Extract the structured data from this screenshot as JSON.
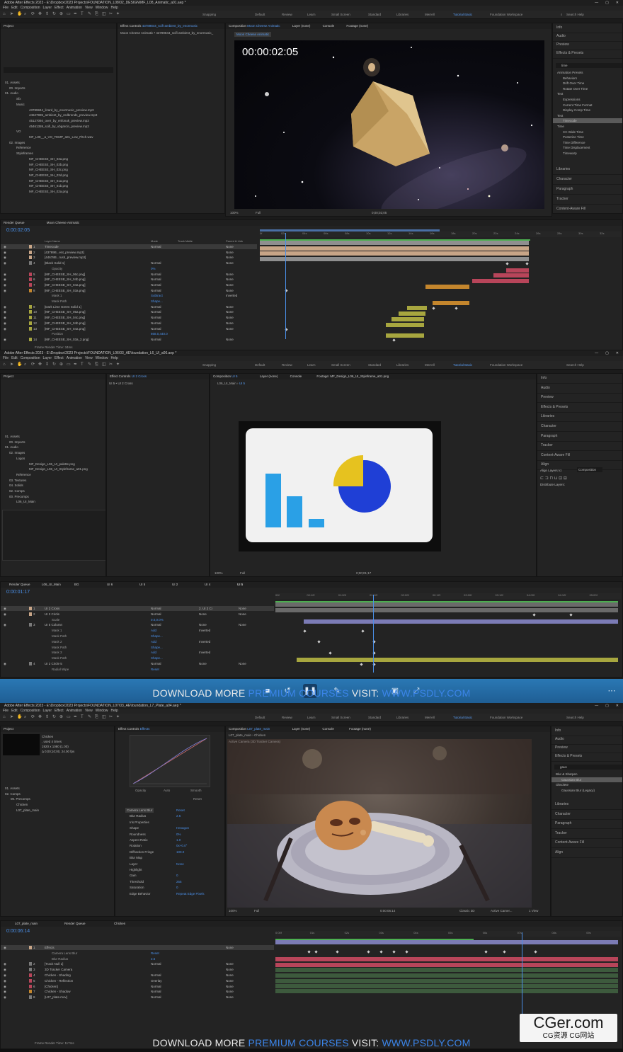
{
  "s1": {
    "title": "Adobe After Effects 2023 - E:\\Dropbox\\2023 Projects\\FOUNDATION_L08\\02_DESIGN\\MF_L08_Animatic_a01.aep *",
    "menu": [
      "File",
      "Edit",
      "Composition",
      "Layer",
      "Effect",
      "Animation",
      "View",
      "Window",
      "Help"
    ],
    "workspaces": [
      "Snapping",
      "Default",
      "Review",
      "Learn",
      "Small Screen",
      "Standard",
      "Libraries",
      "Merrell",
      "Tutorial Basic",
      "Foundation Workspace"
    ],
    "search_help": "Search Help",
    "project_tab": "Project",
    "effect_controls_tab": "Effect Controls",
    "effect_controls_layer": "43789844_scifi-ambient_by_enormusic",
    "effect_controls_sub": "Moon Cheese Animatic • 43789844_scifi-ambient_by_enormusic_",
    "comp_tab": "Composition",
    "comp_name": "Moon Cheese Animatic",
    "layer_tab": "Layer (none)",
    "console_tab": "Console",
    "footage_tab": "Footage (none)",
    "viewer_chip": "Moon Cheese Animatic",
    "timecode_overlay": "00:00:02:05",
    "zoom": "100%",
    "quality": "Full",
    "viewer_time": "0;00;02;05",
    "project_items": [
      "01. Assets",
      "00. Imports",
      "01. Audio",
      "Sfx",
      "Music",
      "43789844_lizard_by_enormusic_preview.mp3",
      "44627985_ambient_by_redbrends_preview.mp3",
      "45127094_over_by_enfonuk_preview.mp3",
      "45461359_scifi_by_vbgarcin_preview.mp3",
      "VO",
      "MF_L08__a_VO_TEMP_a01_Low_Pitch.wav",
      "02. Images",
      "Reference",
      "Styleframes",
      "MF_CHEESE_SH_03a.png",
      "MF_CHEESE_SH_03b.png",
      "MF_CHEESE_SH_03c.png",
      "MF_CHEESE_SH_03d.png",
      "MF_CHEESE_SH_01a.png",
      "MF_CHEESE_SH_01b.png",
      "MF_CHEESE_SH_02a.png"
    ],
    "right_panels": [
      "Info",
      "Audio",
      "Preview",
      "Effects & Presets"
    ],
    "effects_search": "time",
    "effects_tree": [
      "Animation Presets",
      "Behaviors",
      "Drift Over Time",
      "Rotate Over Time",
      "Text",
      "Expressions",
      "Current Time Format",
      "Display Comp Time",
      "Text",
      "Timecode",
      "Time",
      "CC Wide Time",
      "Posterize Time",
      "Time Difference",
      "Time Displacement",
      "Timewarp"
    ],
    "right_panels2": [
      "Libraries",
      "Character",
      "Paragraph",
      "Tracker",
      "Content-Aware Fill"
    ],
    "render_queue_tab": "Render Queue",
    "timeline_tab": "Moon Cheese Animatic",
    "timeline_time": "0:00:02:05",
    "layer_col": "Layer Name",
    "mode_col": "Mode",
    "matte_col": "Track Matte",
    "parent_col": "Parent & Link",
    "layers": [
      {
        "n": "1",
        "name": "Timecode",
        "mode": "Normal",
        "parent": "None"
      },
      {
        "n": "2",
        "name": "[43789B...ent_preview.mp3]",
        "mode": "",
        "parent": "None"
      },
      {
        "n": "3",
        "name": "[44678B...rush_preview.mp3]",
        "mode": "",
        "parent": "None"
      },
      {
        "n": "4",
        "name": "[Black Solid 1]",
        "mode": "Normal",
        "parent": "None"
      },
      {
        "n": "",
        "name": "Opacity",
        "mode": "0%",
        "parent": ""
      },
      {
        "n": "5",
        "name": "[MF_CHEESE_SH_06c.png]",
        "mode": "Normal",
        "parent": "None"
      },
      {
        "n": "6",
        "name": "[MF_CHEESE_SH_04b.png]",
        "mode": "Normal",
        "parent": "None"
      },
      {
        "n": "7",
        "name": "[MF_CHEESE_SH_04a.png]",
        "mode": "Normal",
        "parent": "None"
      },
      {
        "n": "8",
        "name": "[MF_CHEESE_SH_03a.png]",
        "mode": "Normal",
        "parent": "None"
      },
      {
        "n": "",
        "name": "Mask 1",
        "mode": "Subtract",
        "parent": "Inverted"
      },
      {
        "n": "",
        "name": "Mask Path",
        "mode": "Shape...",
        "parent": ""
      },
      {
        "n": "9",
        "name": "[Dark Lime Green Solid 1]",
        "mode": "Normal",
        "parent": "None"
      },
      {
        "n": "10",
        "name": "[MF_CHEESE_SH_05a.png]",
        "mode": "Normal",
        "parent": "None"
      },
      {
        "n": "11",
        "name": "[MF_CHEESE_SH_04c.png]",
        "mode": "Normal",
        "parent": "None"
      },
      {
        "n": "12",
        "name": "[MF_CHEESE_SH_04b.png]",
        "mode": "Normal",
        "parent": "None"
      },
      {
        "n": "13",
        "name": "[MF_CHEESE_SH_04a.png]",
        "mode": "Normal",
        "parent": "None"
      },
      {
        "n": "",
        "name": "Position",
        "mode": "868.0,440.0",
        "parent": ""
      },
      {
        "n": "14",
        "name": "[MF_CHEESE_SH_03a_2.png]",
        "mode": "Normal",
        "parent": "None"
      }
    ],
    "ruler": [
      "0f",
      "02s",
      "04s",
      "06s",
      "08s",
      "10s",
      "12s",
      "14s",
      "16s",
      "18s",
      "20s",
      "22s",
      "24s",
      "26s",
      "28s",
      "30s",
      "32s"
    ],
    "frame_render": "Frame Render Time: 34ms"
  },
  "s2": {
    "title": "Adobe After Effects 2023 - E:\\Dropbox\\2023 Projects\\FOUNDATION_L06\\03_AE\\foundation_L6_UI_a06.aep *",
    "effect_controls": "Effect Controls",
    "effect_controls_layer": "UI 2 Cross",
    "ec_sub": "UI 5 • UI 2 Cross",
    "comp_name": "UI 5",
    "comp_sub": "L06_UI_Main",
    "comp_chip": "UI 5",
    "footage_tab": "Footage: MF_Design_L06_UI_Styleframe_a01.png",
    "project_items": [
      "01. Assets",
      "00. Imports",
      "01. Audio",
      "02. Images",
      "Logos",
      "MF_Design_L06_UI_palette.png",
      "MF_Design_L06_UI_Styleframe_a01.png",
      "Reference",
      "03. Textures",
      "04. Solids",
      "02. Comps",
      "00. Precomps",
      "L06_UI_Main"
    ],
    "right_panels": [
      "Info",
      "Audio",
      "Preview",
      "Effects & Presets",
      "Libraries",
      "Character",
      "Paragraph",
      "Tracker",
      "Content-Aware Fill",
      "Align"
    ],
    "align_to": "Align Layers to:",
    "align_to_val": "Composition",
    "distribute": "Distribute Layers:",
    "timeline_tabs": [
      "Render Queue",
      "L06_UI_Main",
      "BG",
      "UI 6",
      "UI 5",
      "UI 2",
      "UI 4",
      "UI 5"
    ],
    "timeline_time": "0:00:01:17",
    "layers": [
      {
        "n": "1",
        "name": "UI 2 Cross",
        "mode": "Normal",
        "matte": "2. UI 2 Ci",
        "parent": "None"
      },
      {
        "n": "2",
        "name": "UI 2 Circle",
        "mode": "Normal",
        "matte": "None",
        "parent": "None"
      },
      {
        "n": "",
        "name": "Scale",
        "mode": "0.0,0.0%",
        "matte": "",
        "parent": ""
      },
      {
        "n": "3",
        "name": "UI 5 Column",
        "mode": "Normal",
        "matte": "None",
        "parent": "None"
      },
      {
        "n": "",
        "name": "Mask 1",
        "mode": "Add",
        "matte": "Inverted",
        "parent": ""
      },
      {
        "n": "",
        "name": "Mask Path",
        "mode": "Shape...",
        "matte": "",
        "parent": ""
      },
      {
        "n": "",
        "name": "Mask 2",
        "mode": "Add",
        "matte": "Inverted",
        "parent": ""
      },
      {
        "n": "",
        "name": "Mask Path",
        "mode": "Shape...",
        "matte": "",
        "parent": ""
      },
      {
        "n": "",
        "name": "Mask 3",
        "mode": "Add",
        "matte": "Inverted",
        "parent": ""
      },
      {
        "n": "",
        "name": "Mask Path",
        "mode": "Shape...",
        "matte": "",
        "parent": ""
      },
      {
        "n": "4",
        "name": "UI 2 Circle 5",
        "mode": "Normal",
        "matte": "None",
        "parent": "None"
      },
      {
        "n": "",
        "name": "Radial Wipe",
        "mode": "Reset",
        "matte": "",
        "parent": ""
      }
    ],
    "ruler": [
      "00f",
      "00:12f",
      "01:00f",
      "01:12f",
      "02:00f",
      "02:12f",
      "03:00f",
      "03:12f",
      "04:00f",
      "04:12f",
      "05:00f"
    ],
    "zoom": "100%",
    "quality": "Full",
    "viewer_time": "0;00;01;17"
  },
  "banner": {
    "prefix": "DOWNLOAD MORE ",
    "highlight": "PREMIUM COURSES",
    "mid": " VISIT: ",
    "url": "WWW.PSDLY.COM"
  },
  "s3": {
    "title": "Adobe After Effects 2023 - E:\\Dropbox\\2023 Projects\\FOUNDATION_L07\\03_AE\\foundation_L7_Plate_a04.aep *",
    "footage_info": [
      "Chicken",
      ", used 4 times",
      "1920 x 1080 (1.00)",
      "Δ 0;00;10;00, 24.00 fps"
    ],
    "project_items": [
      "01. Assets",
      "02. Comps",
      "00. Precomps",
      "Chicken",
      "L07_plate_main"
    ],
    "effect_controls": "Effect Controls",
    "ec_layer": "Effects",
    "ec_sub": "L07_plate_main • Effects",
    "graph_labels": [
      "Opacity",
      "Auto",
      "Smooth",
      "Reset"
    ],
    "effects": [
      {
        "name": "Camera Lens Blur",
        "val": "Reset"
      },
      {
        "name": "Blur Radius",
        "val": "2.5"
      },
      {
        "name": "Iris Properties",
        "val": ""
      },
      {
        "name": "Shape",
        "val": "Hexagon"
      },
      {
        "name": "Roundness",
        "val": "0%"
      },
      {
        "name": "Aspect Ratio",
        "val": "1.0"
      },
      {
        "name": "Rotation",
        "val": "0x+0.0°"
      },
      {
        "name": "Diffraction Fringe",
        "val": "100.0"
      },
      {
        "name": "Blur Map",
        "val": ""
      },
      {
        "name": "Layer",
        "val": "None"
      },
      {
        "name": "Highlight",
        "val": ""
      },
      {
        "name": "Gain",
        "val": "0"
      },
      {
        "name": "Threshold",
        "val": "255"
      },
      {
        "name": "Saturation",
        "val": "0"
      },
      {
        "name": "Edge Behavior",
        "val": "Repeat Edge Pixels"
      }
    ],
    "comp_name": "L07_plate_main",
    "comp_tabs": [
      "L07_plate_main",
      "Chicken"
    ],
    "active_camera": "Active Camera (3D Tracker Camera)",
    "right_panels": [
      "Info",
      "Audio",
      "Preview",
      "Effects & Presets"
    ],
    "effects_search": "gaus",
    "effects_tree": [
      "Blur & Sharpen",
      "Gaussian Blur",
      "Obsolete",
      "Gaussian Blur (Legacy)"
    ],
    "right_panels2": [
      "Libraries",
      "Character",
      "Paragraph",
      "Tracker",
      "Content-Aware Fill",
      "Align"
    ],
    "timeline_tabs": [
      "L07_plate_main",
      "Render Queue",
      "Chicken"
    ],
    "timeline_time": "0:00:06:14",
    "layers": [
      {
        "n": "1",
        "name": "Effects",
        "mode": "",
        "parent": "None"
      },
      {
        "n": "",
        "name": "Camera Lens Blur",
        "mode": "Reset",
        "parent": ""
      },
      {
        "n": "",
        "name": "Blur Radius",
        "mode": "2.5",
        "parent": ""
      },
      {
        "n": "2",
        "name": "[Track Null 1]",
        "mode": "Normal",
        "parent": "None"
      },
      {
        "n": "3",
        "name": "3D Tracker Camera",
        "mode": "",
        "parent": "None"
      },
      {
        "n": "4",
        "name": "Chicken - Shading",
        "mode": "Normal",
        "parent": "None"
      },
      {
        "n": "5",
        "name": "Chicken - Reflection",
        "mode": "Overlay",
        "parent": "None"
      },
      {
        "n": "6",
        "name": "[Chicken]",
        "mode": "Normal",
        "parent": "None"
      },
      {
        "n": "7",
        "name": "Chicken - Shadow",
        "mode": "Normal",
        "parent": "None"
      },
      {
        "n": "8",
        "name": "[L07_plate.mov]",
        "mode": "Normal",
        "parent": "None"
      }
    ],
    "ruler": [
      "0:00f",
      "01s",
      "02s",
      "03s",
      "04s",
      "05s",
      "06s",
      "07s",
      "08s",
      "09s"
    ],
    "zoom": "100%",
    "quality": "Full",
    "viewer_time": "0:00:06:14",
    "renderer": "Classic 3D",
    "camera": "Active Camer...",
    "views": "1 View",
    "frame_render": "Frame Render Time: 117ms"
  },
  "watermark": {
    "big": "CGer.com",
    "small": "CG资源 CG网站"
  },
  "colors": {
    "accent": "#4a8fe8",
    "lime": "#a7a63f",
    "rose": "#b8455a",
    "peach": "#c8a587",
    "orange": "#c4862d",
    "purple": "#7b7bb5",
    "uiblue": "#2aa0e6",
    "uiyellow": "#e6c21f",
    "uideep": "#1f3fd6"
  }
}
